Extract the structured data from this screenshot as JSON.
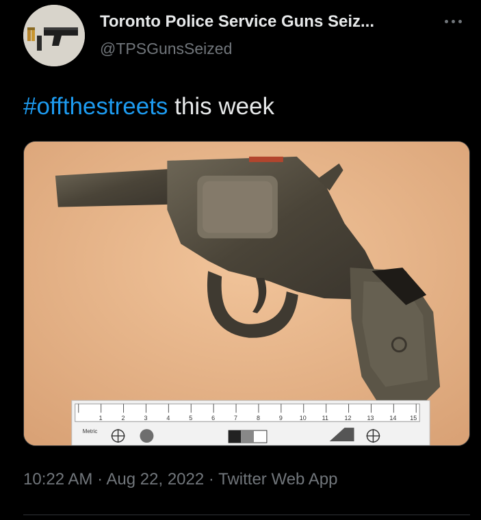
{
  "author": {
    "display_name": "Toronto Police Service Guns Seiz...",
    "handle": "@TPSGunsSeized",
    "avatar_icon": "handgun-icon"
  },
  "tweet": {
    "hashtag": "#offthestreets",
    "text": " this week"
  },
  "media": {
    "ruler_label": "Metric",
    "ruler_numbers": [
      "1",
      "2",
      "3",
      "4",
      "5",
      "6",
      "7",
      "8",
      "9",
      "10",
      "11",
      "12",
      "13",
      "14",
      "15"
    ]
  },
  "meta": {
    "time": "10:22 AM",
    "sep1": " · ",
    "date": "Aug 22, 2022",
    "sep2": " · ",
    "source": "Twitter Web App"
  },
  "colors": {
    "background": "#000000",
    "text": "#e7e9ea",
    "secondary": "#71767b",
    "link": "#1d9bf0"
  }
}
